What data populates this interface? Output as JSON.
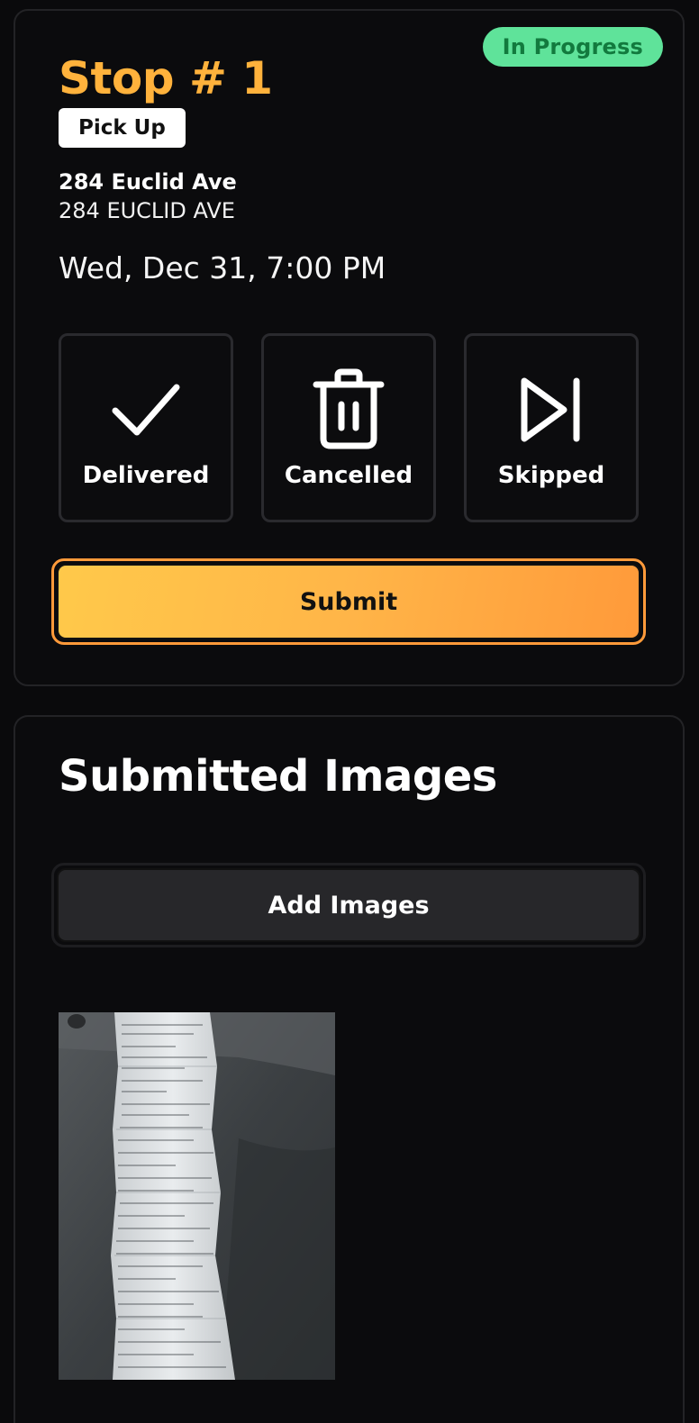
{
  "stop": {
    "status": "In Progress",
    "title": "Stop # 1",
    "type": "Pick Up",
    "address_name": "284 Euclid Ave",
    "address_line": "284 EUCLID AVE",
    "datetime": "Wed, Dec 31, 7:00 PM",
    "actions": [
      {
        "label": "Delivered",
        "icon": "check-icon"
      },
      {
        "label": "Cancelled",
        "icon": "trash-icon"
      },
      {
        "label": "Skipped",
        "icon": "skip-next-icon"
      }
    ],
    "submit_label": "Submit"
  },
  "images": {
    "title": "Submitted Images",
    "add_label": "Add Images",
    "thumbnails": [
      {
        "description": "receipt-photo"
      }
    ]
  },
  "colors": {
    "accent": "#ffb23c",
    "status_bg": "#5fe39a",
    "status_text": "#127a3e",
    "background": "#0a0a0c"
  }
}
